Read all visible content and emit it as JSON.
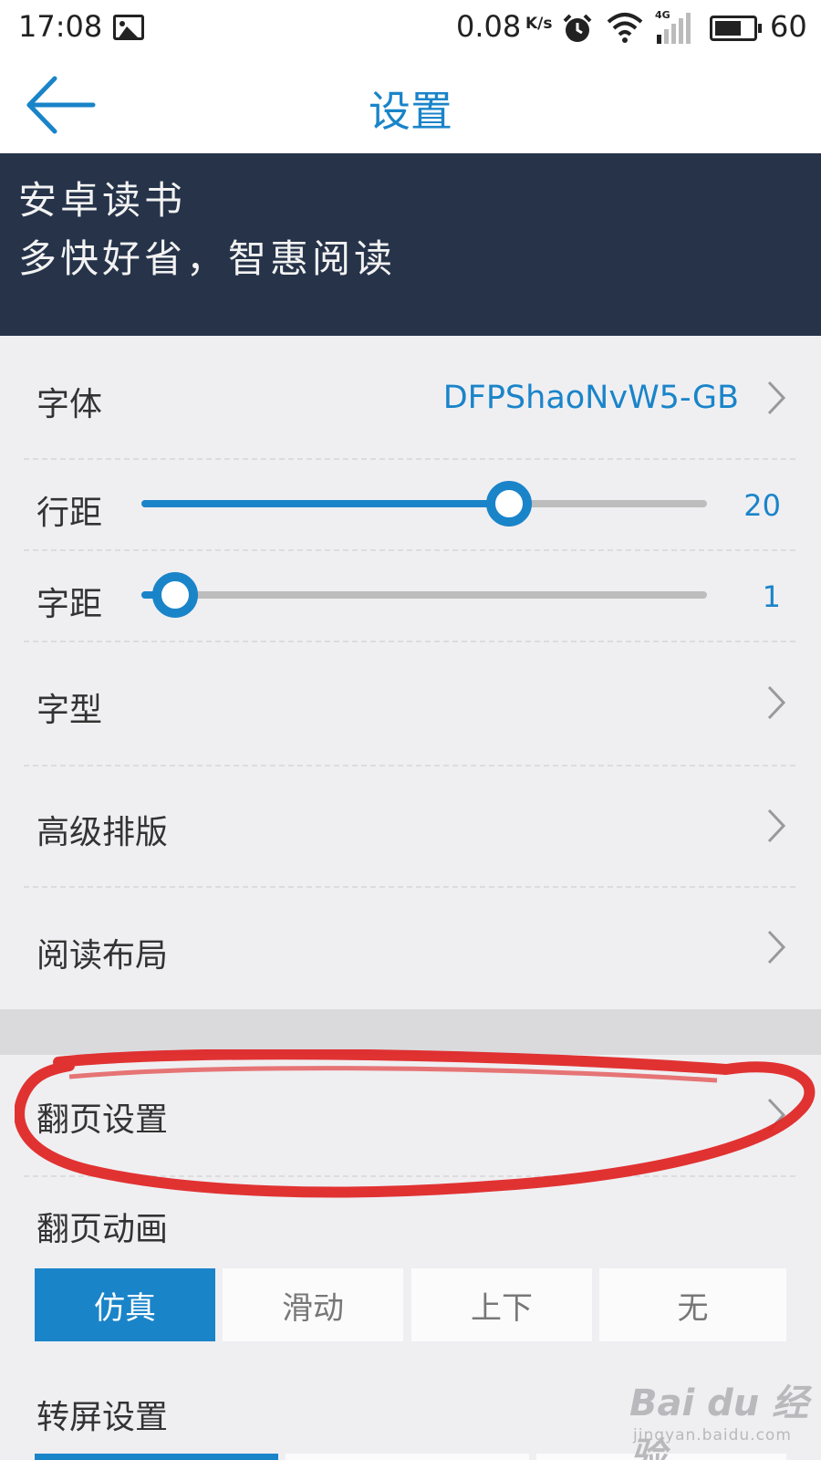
{
  "status_bar": {
    "time": "17:08",
    "net_speed": "0.08",
    "net_speed_unit": "K/s",
    "signal_type": "4G",
    "battery": "60"
  },
  "header": {
    "title": "设置"
  },
  "banner": {
    "line1": "安卓读书",
    "line2": "多快好省，智惠阅读"
  },
  "settings": {
    "font": {
      "label": "字体",
      "value": "DFPShaoNvW5-GB"
    },
    "line_spacing": {
      "label": "行距",
      "value": "20",
      "level": 0.65
    },
    "char_spacing": {
      "label": "字距",
      "value": "1",
      "level": 0.06
    },
    "typeface": {
      "label": "字型"
    },
    "advanced_layout": {
      "label": "高级排版"
    },
    "reading_layout": {
      "label": "阅读布局"
    }
  },
  "page_turn": {
    "label": "翻页设置",
    "animation_label": "翻页动画",
    "options": [
      "仿真",
      "滑动",
      "上下",
      "无"
    ],
    "selected_index": 0
  },
  "rotation": {
    "label": "转屏设置"
  },
  "watermark": {
    "main": "Bai du 经验",
    "sub": "jingyan.baidu.com"
  },
  "colors": {
    "accent": "#1a84c9",
    "banner_bg": "#263349",
    "page_bg": "#efeff2",
    "annotation": "#e02222"
  }
}
